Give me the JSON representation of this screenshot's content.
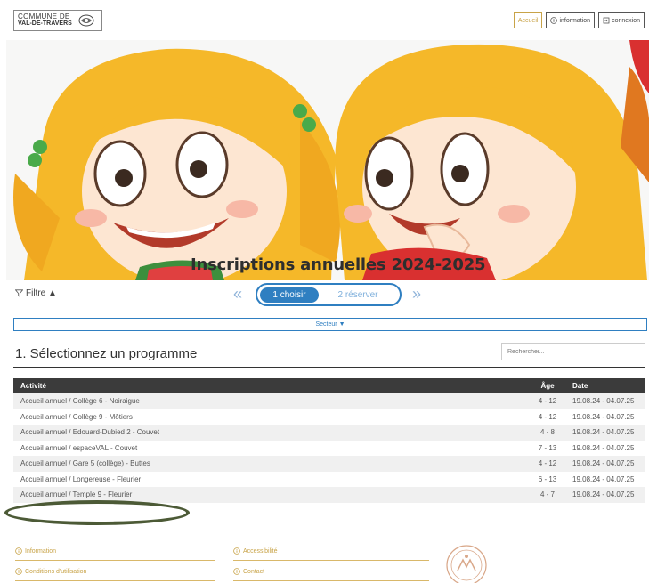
{
  "header": {
    "logo_line1": "COMMUNE DE",
    "logo_line2": "VAL-DE-TRAVERS",
    "nav": {
      "accueil": "Accueil",
      "information": "information",
      "connexion": "connexion"
    }
  },
  "banner": {
    "title": "Inscriptions annuelles 2024-2025"
  },
  "toolbar": {
    "filter_label": "Filtre ▲",
    "prev": "«",
    "next": "»",
    "step1": "1 choisir",
    "step2": "2 réserver",
    "secteur": "Secteur ▼"
  },
  "program": {
    "title": "1. Sélectionnez un programme",
    "search_placeholder": "Rechercher..."
  },
  "table": {
    "headers": {
      "activity": "Activité",
      "age": "Âge",
      "date": "Date"
    },
    "rows": [
      {
        "activity": "Accueil annuel / Collège 6 - Noiraigue",
        "age": "4 - 12",
        "date": "19.08.24 - 04.07.25"
      },
      {
        "activity": "Accueil annuel / Collège 9 - Môtiers",
        "age": "4 - 12",
        "date": "19.08.24 - 04.07.25"
      },
      {
        "activity": "Accueil annuel / Edouard-Dubied 2 - Couvet",
        "age": "4 - 8",
        "date": "19.08.24 - 04.07.25"
      },
      {
        "activity": "Accueil annuel / espaceVAL - Couvet",
        "age": "7 - 13",
        "date": "19.08.24 - 04.07.25"
      },
      {
        "activity": "Accueil annuel / Gare 5 (collège) - Buttes",
        "age": "4 - 12",
        "date": "19.08.24 - 04.07.25"
      },
      {
        "activity": "Accueil annuel / Longereuse - Fleurier",
        "age": "6 - 13",
        "date": "19.08.24 - 04.07.25"
      },
      {
        "activity": "Accueil annuel / Temple 9 - Fleurier",
        "age": "4 - 7",
        "date": "19.08.24 - 04.07.25"
      }
    ]
  },
  "footer": {
    "information": "Information",
    "conditions": "Conditions d'utilisation",
    "accessibilite": "Accessibilité",
    "contact": "Contact"
  },
  "colors": {
    "accent_gold": "#c8a348",
    "accent_blue": "#2f7fc1",
    "table_header": "#3b3b3b",
    "highlight_ring": "#4c5a36"
  }
}
